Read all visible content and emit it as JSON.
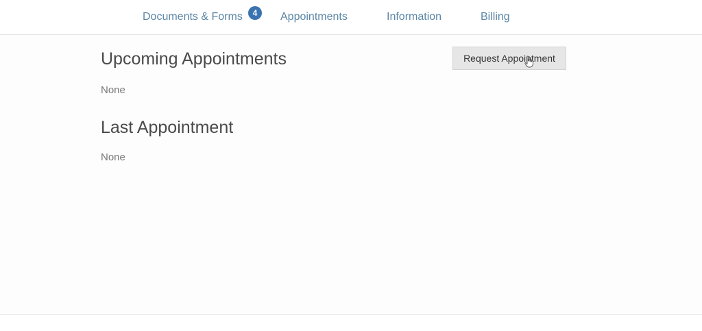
{
  "nav": {
    "items": [
      {
        "label": "Documents & Forms",
        "badge": "4"
      },
      {
        "label": "Appointments"
      },
      {
        "label": "Information"
      },
      {
        "label": "Billing"
      }
    ]
  },
  "upcoming": {
    "title": "Upcoming Appointments",
    "value": "None",
    "button_label": "Request Appointment"
  },
  "last": {
    "title": "Last Appointment",
    "value": "None"
  },
  "colors": {
    "nav_link": "#5b86a6",
    "badge": "#3a73b0",
    "button_bg": "#e6e6e6"
  }
}
